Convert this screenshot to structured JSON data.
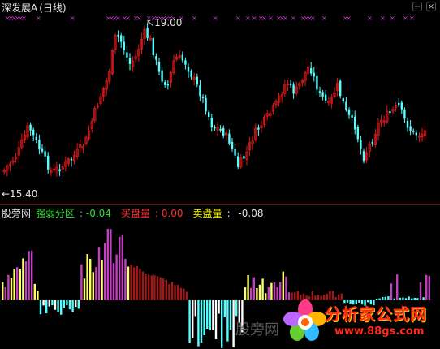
{
  "header": {
    "title": "深发展A",
    "period": "(日线)"
  },
  "price": {
    "high_label": "19.00",
    "low_label": "←15.40"
  },
  "indicator": {
    "source": "股旁网",
    "name": "强弱分区",
    "name_value": "-0.04",
    "buy_label": "买盘量",
    "buy_value": "0.00",
    "sell_label": "卖盘量",
    "sell_value": "-0.08"
  },
  "watermark": {
    "text": "股旁网",
    "logo_cn": "分析家公式网",
    "logo_url": "www.88gs.com"
  },
  "colors": {
    "up": "#e01818",
    "down": "#54ffff",
    "magenta": "#c040c0",
    "yellow": "#ffff66",
    "darkred": "#a01818",
    "white": "#ffffff",
    "green_text": "#33dd33",
    "red_text": "#ff3333",
    "yellow_text": "#ffff00",
    "signal": "#cc44cc"
  }
}
